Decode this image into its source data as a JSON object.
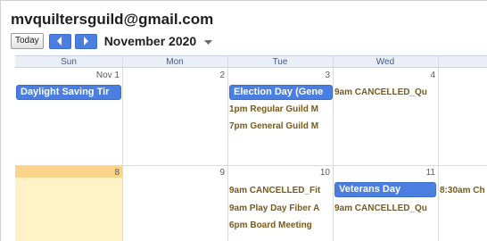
{
  "calendar": {
    "title": "mvquiltersguild@gmail.com",
    "today_label": "Today",
    "month_label": "November 2020"
  },
  "icons": {
    "prev": "chevron-left-icon",
    "next": "chevron-right-icon",
    "month_dropdown": "caret-down-icon"
  },
  "colors": {
    "event_blue": "#4a7ee0",
    "today_highlight": "#fff2c6",
    "today_header": "#f9d48a",
    "timed_text": "#7a5a1a"
  },
  "weekdays": [
    "Sun",
    "Mon",
    "Tue",
    "Wed",
    "T"
  ],
  "weeks": [
    {
      "days": [
        {
          "label": "Nov 1"
        },
        {
          "label": "2"
        },
        {
          "label": "3"
        },
        {
          "label": "4"
        },
        {
          "label": ""
        }
      ],
      "allday": [
        {
          "title": "Daylight Saving Tir"
        },
        {
          "title": "Election Day (Gene"
        }
      ],
      "timed": [
        {
          "time": "9am",
          "title": "CANCELLED_Qu"
        },
        {
          "time": "1pm",
          "title": "Regular Guild M"
        },
        {
          "time": "7pm",
          "title": "General Guild M"
        }
      ]
    },
    {
      "days": [
        {
          "label": "8",
          "today": true
        },
        {
          "label": "9"
        },
        {
          "label": "10"
        },
        {
          "label": "11"
        },
        {
          "label": ""
        }
      ],
      "allday": [
        {
          "title": "Veterans Day"
        }
      ],
      "timed": [
        {
          "time": "9am",
          "title": "CANCELLED_Fit"
        },
        {
          "time": "9am",
          "title": "Play Day Fiber A"
        },
        {
          "time": "6pm",
          "title": "Board Meeting"
        },
        {
          "time": "9am",
          "title": "CANCELLED_Qu"
        },
        {
          "time": "8:30am",
          "title": "Ch"
        }
      ]
    }
  ]
}
